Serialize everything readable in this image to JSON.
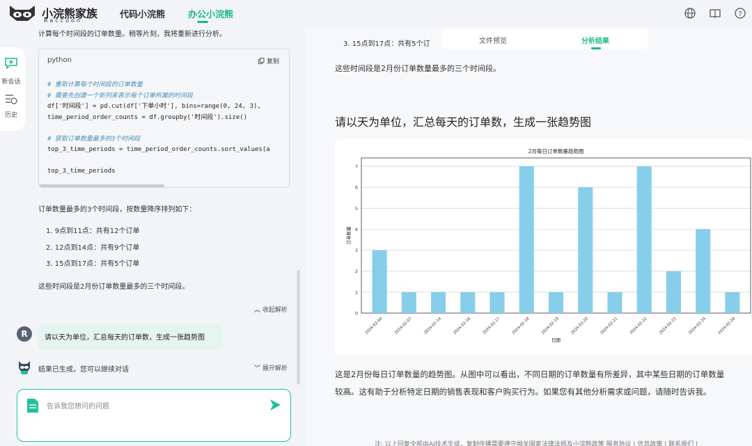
{
  "app": {
    "name": "小浣熊家族",
    "subtitle": "Raccoon"
  },
  "nav": {
    "tabs": [
      {
        "label": "代码小浣熊",
        "active": false
      },
      {
        "label": "办公小浣熊",
        "active": true
      }
    ],
    "accent": "#1db98a"
  },
  "rail": {
    "new_chat": "新会话",
    "history": "历史"
  },
  "chat": {
    "cut_text": "计算每个时间段的订单数量。稍等片刻，我将重新进行分析。",
    "code": {
      "lang": "python",
      "copy_label": "复制",
      "lines": [
        {
          "text": "# 重新计算每个时间段的订单数量",
          "comment": true
        },
        {
          "text": "# 需要先创建一个新列来表示每个订单所属的时间段",
          "comment": true
        },
        {
          "text": "df['时间段'] = pd.cut(df['下单小时'], bins=range(0, 24, 3),",
          "comment": false
        },
        {
          "text": "time_period_order_counts = df.groupby('时间段').size()",
          "comment": false
        },
        {
          "text": "",
          "comment": false
        },
        {
          "text": "# 获取订单数量最多的3个时间段",
          "comment": true
        },
        {
          "text": "top_3_time_periods = time_period_order_counts.sort_values(a",
          "comment": false
        },
        {
          "text": "",
          "comment": false
        },
        {
          "text": "top_3_time_periods",
          "comment": false
        }
      ]
    },
    "intro": "订单数量最多的3个时间段，按数量降序排列如下：",
    "list": [
      "1. 9点到11点：共有12个订单",
      "2. 12点到14点：共有9个订单",
      "3. 15点到17点：共有5个订单"
    ],
    "conclusion": "这些时间段是2月份订单数量最多的三个时间段。",
    "collapse_label": "收起解析",
    "user_avatar": "R",
    "user_message": "请以天为单位，汇总每天的订单数，生成一张趋势图",
    "bot_status": "结果已生成，您可以继续对话",
    "expand_label": "展开解析",
    "input_placeholder": "告诉我您想问的问题"
  },
  "panel": {
    "tabs": [
      {
        "label": "文件预览",
        "active": false
      },
      {
        "label": "分析结果",
        "active": true
      }
    ],
    "top_item": "3. 15点到17点：共有5个订",
    "summary": "这些时间段是2月份订单数量最多的三个时间段。",
    "heading": "请以天为单位，汇总每天的订单数，生成一张趋势图",
    "description_line1": "这是2月份每日订单数量的趋势图。从图中可以看出，不同日期的订单数量有所差异，其中某些日期的订单数量",
    "description_line2": "较高。这有助于分析特定日期的销售表现和客户购买行为。如果您有其他分析需求或问题，请随时告诉我。",
    "footer": "注: 以上回复全部由AI技术生成，复制传播需要遵守相关国家法律法规及小浣熊政策 服务协议 | 信息政策 | 联系我们 |"
  },
  "chart_data": {
    "type": "bar",
    "title": "2月每日订单数量趋势图",
    "xlabel": "日期",
    "ylabel": "订单数量",
    "categories": [
      "2024-02-04",
      "2024-02-07",
      "2024-02-14",
      "2024-02-16",
      "2024-02-17",
      "2024-02-18",
      "2024-02-19",
      "2024-02-20",
      "2024-02-21",
      "2024-02-22",
      "2024-02-23",
      "2024-02-24",
      "2024-02-28"
    ],
    "values": [
      3,
      1,
      1,
      1,
      1,
      7,
      1,
      6,
      1,
      7,
      2,
      4,
      1
    ],
    "ylim": [
      0,
      7
    ],
    "yticks": [
      0,
      1,
      2,
      3,
      4,
      5,
      6,
      7
    ],
    "grid": true,
    "bar_color": "#87ceeb"
  }
}
